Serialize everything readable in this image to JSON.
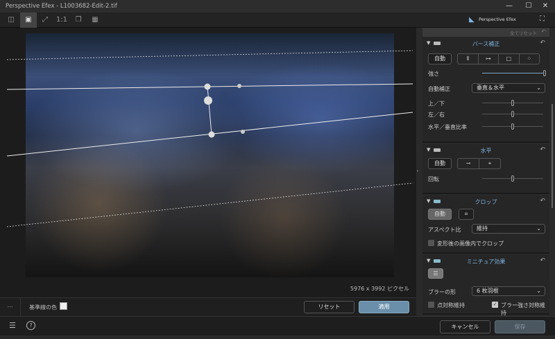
{
  "window": {
    "title": "Perspective Efex - L1003682-Edit-2.tif",
    "minimize": "—",
    "maximize": "☐",
    "close": "✕"
  },
  "toolbar": {
    "one_to_one": "1:1",
    "brand": "Perspective Efex"
  },
  "canvas": {
    "pixel_info": "5976 x 3992 ピクセル"
  },
  "bottom": {
    "guide_color_label": "基準線の色",
    "guide_color": "#f0f0f0",
    "reset": "リセット",
    "apply": "適用"
  },
  "footer": {
    "cancel": "キャンセル",
    "save": "保存"
  },
  "panel": {
    "reset_all": "全てリセット",
    "perspective": {
      "title": "パース補正",
      "auto": "自動",
      "strength_label": "強さ",
      "strength": 1.0,
      "auto_correct_label": "自動補正",
      "auto_correct_value": "垂直＆水平",
      "sliders": [
        {
          "label": "上／下",
          "value": 0.5
        },
        {
          "label": "左／右",
          "value": 0.5
        },
        {
          "label": "水平／垂直比率",
          "value": 0.5
        }
      ]
    },
    "horizontal": {
      "title": "水平",
      "auto": "自動",
      "rotation_label": "回転",
      "rotation": 0.5
    },
    "crop": {
      "title": "クロップ",
      "auto": "自動",
      "aspect_label": "アスペクト比",
      "aspect_value": "維持",
      "crop_in_image": "変形後の画像内でクロップ",
      "crop_in_image_checked": false
    },
    "miniature": {
      "title": "ミニチュア効果",
      "blur_shape_label": "ブラーの形",
      "blur_shape_value": "6 枚羽根",
      "keep_point_sym": "点対称維持",
      "keep_point_sym_checked": false,
      "keep_blur_sym": "ブラー強さ対称維持",
      "keep_blur_sym_checked": true
    }
  }
}
